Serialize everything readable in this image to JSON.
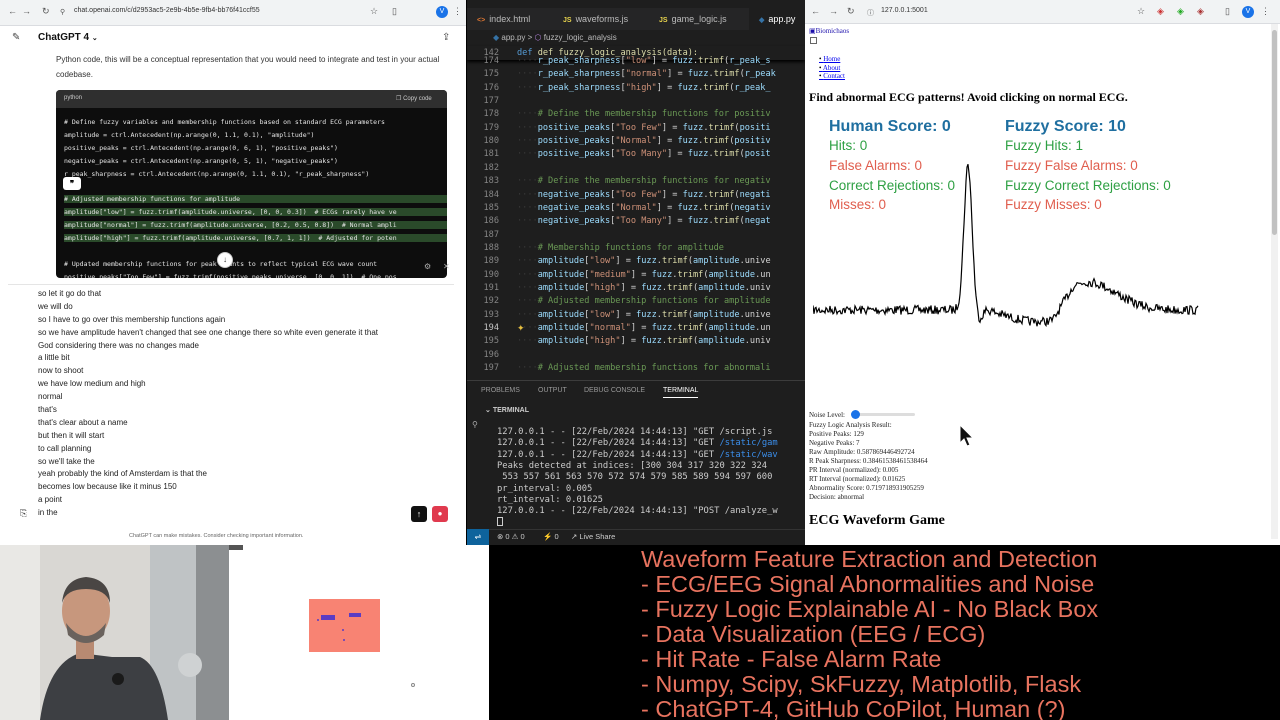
{
  "chat": {
    "url": "chat.openai.com/c/d2953ac5-2e9b-4b5e-9fb4-bb76f41ccf55",
    "model_label": "ChatGPT 4",
    "intro_text": "Python code, this will be a conceptual representation that you would need to integrate and test in your actual codebase.",
    "code_lang": "python",
    "copy_label": "Copy code",
    "code_lines": [
      "# Define fuzzy variables and membership functions based on standard ECG parameters",
      "amplitude = ctrl.Antecedent(np.arange(0, 1.1, 0.1), \"amplitude\")",
      "positive_peaks = ctrl.Antecedent(np.arange(0, 6, 1), \"positive_peaks\")",
      "negative_peaks = ctrl.Antecedent(np.arange(0, 5, 1), \"negative_peaks\")",
      "r_peak_sharpness = ctrl.Antecedent(np.arange(0, 1.1, 0.1), \"r_peak_sharpness\")",
      "",
      "# Adjusted membership functions for amplitude",
      "amplitude[\"low\"] = fuzz.trimf(amplitude.universe, [0, 0, 0.3])  # ECGs rarely have ve",
      "amplitude[\"normal\"] = fuzz.trimf(amplitude.universe, [0.2, 0.5, 0.8])  # Normal ampli",
      "amplitude[\"high\"] = fuzz.trimf(amplitude.universe, [0.7, 1, 1])  # Adjusted for poten",
      "",
      "# Updated membership functions for peak counts to reflect typical ECG wave count",
      "positive_peaks[\"Too Few\"] = fuzz.trimf(positive_peaks.universe, [0, 0, 1])  # One pos"
    ],
    "transcript": [
      "so let it go do that",
      "we will do",
      "so I have to go over this membership functions again",
      "so we have amplitude haven't changed that see one change there so white even generate it that",
      "God considering there was no changes made",
      "a little bit",
      "now to shoot",
      "we have low medium and high",
      "normal",
      "that's",
      "that's clear about a name",
      "but then it will start",
      "to call planning",
      "so we'll take the",
      "yeah probably the kind of Amsterdam is that the",
      "becomes low because like it minus 150",
      "a point",
      "in the"
    ],
    "disclaimer": "ChatGPT can make mistakes. Consider checking important information."
  },
  "vscode": {
    "tabs": [
      {
        "label": "index.html",
        "icon": "<>"
      },
      {
        "label": "waveforms.js",
        "icon": "JS"
      },
      {
        "label": "game_logic.js",
        "icon": "JS"
      },
      {
        "label": "app.py",
        "icon": ""
      }
    ],
    "breadcrumb_file": "app.py",
    "breadcrumb_symbol": "fuzzy_logic_analysis",
    "sticky_line_no": "142",
    "sticky_line": "def fuzzy_logic_analysis(data):",
    "lines": [
      {
        "n": "174",
        "t": "r_peak_sharpness[\"low\"] = fuzz.trimf(r_peak_s"
      },
      {
        "n": "175",
        "t": "r_peak_sharpness[\"normal\"] = fuzz.trimf(r_peak"
      },
      {
        "n": "176",
        "t": "r_peak_sharpness[\"high\"] = fuzz.trimf(r_peak_"
      },
      {
        "n": "177",
        "t": ""
      },
      {
        "n": "178",
        "t": "# Define the membership functions for positiv"
      },
      {
        "n": "179",
        "t": "positive_peaks[\"Too Few\"] = fuzz.trimf(positi"
      },
      {
        "n": "180",
        "t": "positive_peaks[\"Normal\"] = fuzz.trimf(positiv"
      },
      {
        "n": "181",
        "t": "positive_peaks[\"Too Many\"] = fuzz.trimf(posit"
      },
      {
        "n": "182",
        "t": ""
      },
      {
        "n": "183",
        "t": "# Define the membership functions for negativ"
      },
      {
        "n": "184",
        "t": "negative_peaks[\"Too Few\"] = fuzz.trimf(negati"
      },
      {
        "n": "185",
        "t": "negative_peaks[\"Normal\"] = fuzz.trimf(negativ"
      },
      {
        "n": "186",
        "t": "negative_peaks[\"Too Many\"] = fuzz.trimf(negat"
      },
      {
        "n": "187",
        "t": ""
      },
      {
        "n": "188",
        "t": "# Membership functions for amplitude"
      },
      {
        "n": "189",
        "t": "amplitude[\"low\"] = fuzz.trimf(amplitude.unive"
      },
      {
        "n": "190",
        "t": "amplitude[\"medium\"] = fuzz.trimf(amplitude.un"
      },
      {
        "n": "191",
        "t": "amplitude[\"high\"] = fuzz.trimf(amplitude.univ"
      },
      {
        "n": "192",
        "t": "# Adjusted membership functions for amplitude"
      },
      {
        "n": "193",
        "t": "amplitude[\"low\"] = fuzz.trimf(amplitude.unive"
      },
      {
        "n": "194",
        "t": "amplitude[\"normal\"] = fuzz.trimf(amplitude.un"
      },
      {
        "n": "195",
        "t": "amplitude[\"high\"] = fuzz.trimf(amplitude.univ"
      },
      {
        "n": "196",
        "t": ""
      },
      {
        "n": "197",
        "t": "# Adjusted membership functions for abnormali"
      }
    ],
    "panel_tabs": [
      "PROBLEMS",
      "OUTPUT",
      "DEBUG CONSOLE",
      "TERMINAL"
    ],
    "terminal_label": "TERMINAL",
    "terminal_lines": [
      "127.0.0.1 - - [22/Feb/2024 14:44:13] \"GET /script.js",
      "127.0.0.1 - - [22/Feb/2024 14:44:13] \"GET /static/gam",
      "127.0.0.1 - - [22/Feb/2024 14:44:13] \"GET /static/wav",
      "Peaks detected at indices: [300 304 317 320 322 324",
      " 553 557 561 563 570 572 574 579 585 589 594 597 600",
      "pr_interval: 0.005",
      "rt_interval: 0.01625",
      "127.0.0.1 - - [22/Feb/2024 14:44:13] \"POST /analyze_w"
    ],
    "status_errors": "0",
    "status_warnings": "0",
    "status_ports": "0",
    "status_live": "Live Share"
  },
  "game": {
    "url": "127.0.0.1:5001",
    "logo_alt": "Biomichaos",
    "menu": [
      "Home",
      "About",
      "Contact"
    ],
    "heading": "Find abnormal ECG patterns! Avoid clicking on normal ECG.",
    "human": {
      "score_label": "Human Score: 0",
      "hits": "Hits: 0",
      "false_alarms": "False Alarms: 0",
      "correct_rejections": "Correct Rejections: 0",
      "misses": "Misses: 0"
    },
    "fuzzy": {
      "score_label": "Fuzzy Score: 10",
      "hits": "Fuzzy Hits: 1",
      "false_alarms": "Fuzzy False Alarms: 0",
      "correct_rejections": "Fuzzy Correct Rejections: 0",
      "misses": "Fuzzy Misses: 0"
    },
    "noise_label": "Noise Level:",
    "noise_level": 0.0,
    "results": [
      "Fuzzy Logic Analysis Result:",
      "Positive Peaks: 129",
      "Negative Peaks: 7",
      "Raw Amplitude: 0.587869446492724",
      "R Peak Sharpness: 0.38461538461538464",
      "PR Interval (normalized): 0.005",
      "RT Interval (normalized): 0.01625",
      "Abnormality Score: 0.719718931905259",
      "Decision: abnormal"
    ],
    "section_title": "ECG Waveform Game"
  },
  "overlay_lines": [
    "Waveform Feature Extraction and Detection",
    "- ECG/EEG Signal Abnormalities and Noise",
    "- Fuzzy Logic Explainable AI - No Black Box",
    "- Data Visualization (EEG / ECG)",
    "- Hit Rate - False Alarm Rate",
    "- Numpy, Scipy, SkFuzzy, Matplotlib, Flask",
    "- ChatGPT-4, GitHub CoPilot, Human (?)"
  ],
  "colors": {
    "overlay_text": "#e8735f",
    "score_blue": "#1f6fa0",
    "hit_green": "#2ea043",
    "miss_red": "#e05e4e",
    "vscode_bg": "#1e1e1e"
  }
}
